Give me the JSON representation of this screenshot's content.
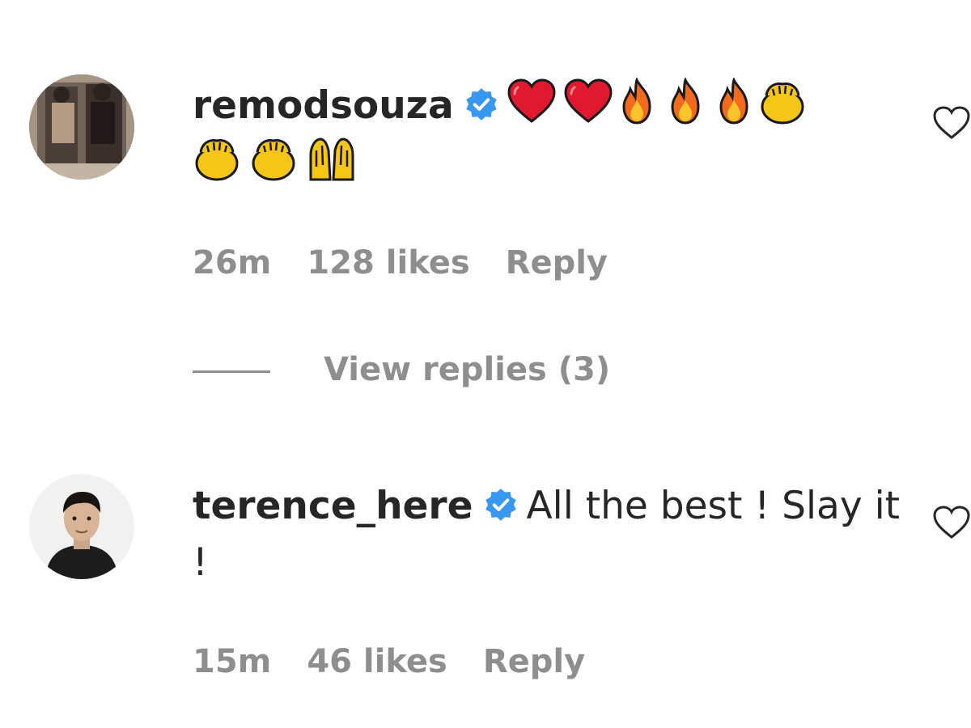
{
  "comments": [
    {
      "username": "remodsouza",
      "verified": true,
      "text": "",
      "emojis": [
        "heart",
        "heart",
        "fire",
        "fire",
        "fire",
        "clap",
        "clap",
        "clap",
        "raising-hands"
      ],
      "time": "26m",
      "likes": "128 likes",
      "reply_label": "Reply",
      "view_replies": "View replies (3)"
    },
    {
      "username": "terence_here",
      "verified": true,
      "text": "All the best ! Slay it !",
      "time": "15m",
      "likes": "46 likes",
      "reply_label": "Reply"
    }
  ],
  "icons": {
    "verified": "verified-badge-icon",
    "like": "heart-outline-icon"
  },
  "colors": {
    "text": "#262626",
    "secondary": "#8e8e8e",
    "verified": "#3897f0",
    "heart": "#e0192e"
  }
}
